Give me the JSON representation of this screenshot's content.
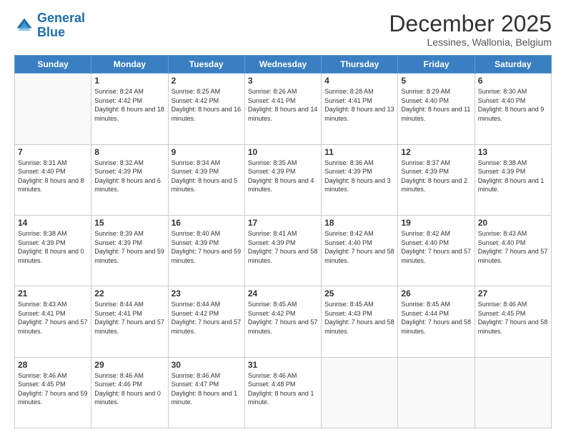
{
  "header": {
    "logo_line1": "General",
    "logo_line2": "Blue",
    "month_title": "December 2025",
    "subtitle": "Lessines, Wallonia, Belgium"
  },
  "days_of_week": [
    "Sunday",
    "Monday",
    "Tuesday",
    "Wednesday",
    "Thursday",
    "Friday",
    "Saturday"
  ],
  "weeks": [
    [
      {
        "day": null
      },
      {
        "day": "1",
        "sunrise": "Sunrise: 8:24 AM",
        "sunset": "Sunset: 4:42 PM",
        "daylight": "Daylight: 8 hours and 18 minutes."
      },
      {
        "day": "2",
        "sunrise": "Sunrise: 8:25 AM",
        "sunset": "Sunset: 4:42 PM",
        "daylight": "Daylight: 8 hours and 16 minutes."
      },
      {
        "day": "3",
        "sunrise": "Sunrise: 8:26 AM",
        "sunset": "Sunset: 4:41 PM",
        "daylight": "Daylight: 8 hours and 14 minutes."
      },
      {
        "day": "4",
        "sunrise": "Sunrise: 8:28 AM",
        "sunset": "Sunset: 4:41 PM",
        "daylight": "Daylight: 8 hours and 13 minutes."
      },
      {
        "day": "5",
        "sunrise": "Sunrise: 8:29 AM",
        "sunset": "Sunset: 4:40 PM",
        "daylight": "Daylight: 8 hours and 11 minutes."
      },
      {
        "day": "6",
        "sunrise": "Sunrise: 8:30 AM",
        "sunset": "Sunset: 4:40 PM",
        "daylight": "Daylight: 8 hours and 9 minutes."
      }
    ],
    [
      {
        "day": "7",
        "sunrise": "Sunrise: 8:31 AM",
        "sunset": "Sunset: 4:40 PM",
        "daylight": "Daylight: 8 hours and 8 minutes."
      },
      {
        "day": "8",
        "sunrise": "Sunrise: 8:32 AM",
        "sunset": "Sunset: 4:39 PM",
        "daylight": "Daylight: 8 hours and 6 minutes."
      },
      {
        "day": "9",
        "sunrise": "Sunrise: 8:34 AM",
        "sunset": "Sunset: 4:39 PM",
        "daylight": "Daylight: 8 hours and 5 minutes."
      },
      {
        "day": "10",
        "sunrise": "Sunrise: 8:35 AM",
        "sunset": "Sunset: 4:39 PM",
        "daylight": "Daylight: 8 hours and 4 minutes."
      },
      {
        "day": "11",
        "sunrise": "Sunrise: 8:36 AM",
        "sunset": "Sunset: 4:39 PM",
        "daylight": "Daylight: 8 hours and 3 minutes."
      },
      {
        "day": "12",
        "sunrise": "Sunrise: 8:37 AM",
        "sunset": "Sunset: 4:39 PM",
        "daylight": "Daylight: 8 hours and 2 minutes."
      },
      {
        "day": "13",
        "sunrise": "Sunrise: 8:38 AM",
        "sunset": "Sunset: 4:39 PM",
        "daylight": "Daylight: 8 hours and 1 minute."
      }
    ],
    [
      {
        "day": "14",
        "sunrise": "Sunrise: 8:38 AM",
        "sunset": "Sunset: 4:39 PM",
        "daylight": "Daylight: 8 hours and 0 minutes."
      },
      {
        "day": "15",
        "sunrise": "Sunrise: 8:39 AM",
        "sunset": "Sunset: 4:39 PM",
        "daylight": "Daylight: 7 hours and 59 minutes."
      },
      {
        "day": "16",
        "sunrise": "Sunrise: 8:40 AM",
        "sunset": "Sunset: 4:39 PM",
        "daylight": "Daylight: 7 hours and 59 minutes."
      },
      {
        "day": "17",
        "sunrise": "Sunrise: 8:41 AM",
        "sunset": "Sunset: 4:39 PM",
        "daylight": "Daylight: 7 hours and 58 minutes."
      },
      {
        "day": "18",
        "sunrise": "Sunrise: 8:42 AM",
        "sunset": "Sunset: 4:40 PM",
        "daylight": "Daylight: 7 hours and 58 minutes."
      },
      {
        "day": "19",
        "sunrise": "Sunrise: 8:42 AM",
        "sunset": "Sunset: 4:40 PM",
        "daylight": "Daylight: 7 hours and 57 minutes."
      },
      {
        "day": "20",
        "sunrise": "Sunrise: 8:43 AM",
        "sunset": "Sunset: 4:40 PM",
        "daylight": "Daylight: 7 hours and 57 minutes."
      }
    ],
    [
      {
        "day": "21",
        "sunrise": "Sunrise: 8:43 AM",
        "sunset": "Sunset: 4:41 PM",
        "daylight": "Daylight: 7 hours and 57 minutes."
      },
      {
        "day": "22",
        "sunrise": "Sunrise: 8:44 AM",
        "sunset": "Sunset: 4:41 PM",
        "daylight": "Daylight: 7 hours and 57 minutes."
      },
      {
        "day": "23",
        "sunrise": "Sunrise: 8:44 AM",
        "sunset": "Sunset: 4:42 PM",
        "daylight": "Daylight: 7 hours and 57 minutes."
      },
      {
        "day": "24",
        "sunrise": "Sunrise: 8:45 AM",
        "sunset": "Sunset: 4:42 PM",
        "daylight": "Daylight: 7 hours and 57 minutes."
      },
      {
        "day": "25",
        "sunrise": "Sunrise: 8:45 AM",
        "sunset": "Sunset: 4:43 PM",
        "daylight": "Daylight: 7 hours and 58 minutes."
      },
      {
        "day": "26",
        "sunrise": "Sunrise: 8:45 AM",
        "sunset": "Sunset: 4:44 PM",
        "daylight": "Daylight: 7 hours and 58 minutes."
      },
      {
        "day": "27",
        "sunrise": "Sunrise: 8:46 AM",
        "sunset": "Sunset: 4:45 PM",
        "daylight": "Daylight: 7 hours and 58 minutes."
      }
    ],
    [
      {
        "day": "28",
        "sunrise": "Sunrise: 8:46 AM",
        "sunset": "Sunset: 4:45 PM",
        "daylight": "Daylight: 7 hours and 59 minutes."
      },
      {
        "day": "29",
        "sunrise": "Sunrise: 8:46 AM",
        "sunset": "Sunset: 4:46 PM",
        "daylight": "Daylight: 8 hours and 0 minutes."
      },
      {
        "day": "30",
        "sunrise": "Sunrise: 8:46 AM",
        "sunset": "Sunset: 4:47 PM",
        "daylight": "Daylight: 8 hours and 1 minute."
      },
      {
        "day": "31",
        "sunrise": "Sunrise: 8:46 AM",
        "sunset": "Sunset: 4:48 PM",
        "daylight": "Daylight: 8 hours and 1 minute."
      },
      {
        "day": null
      },
      {
        "day": null
      },
      {
        "day": null
      }
    ]
  ]
}
